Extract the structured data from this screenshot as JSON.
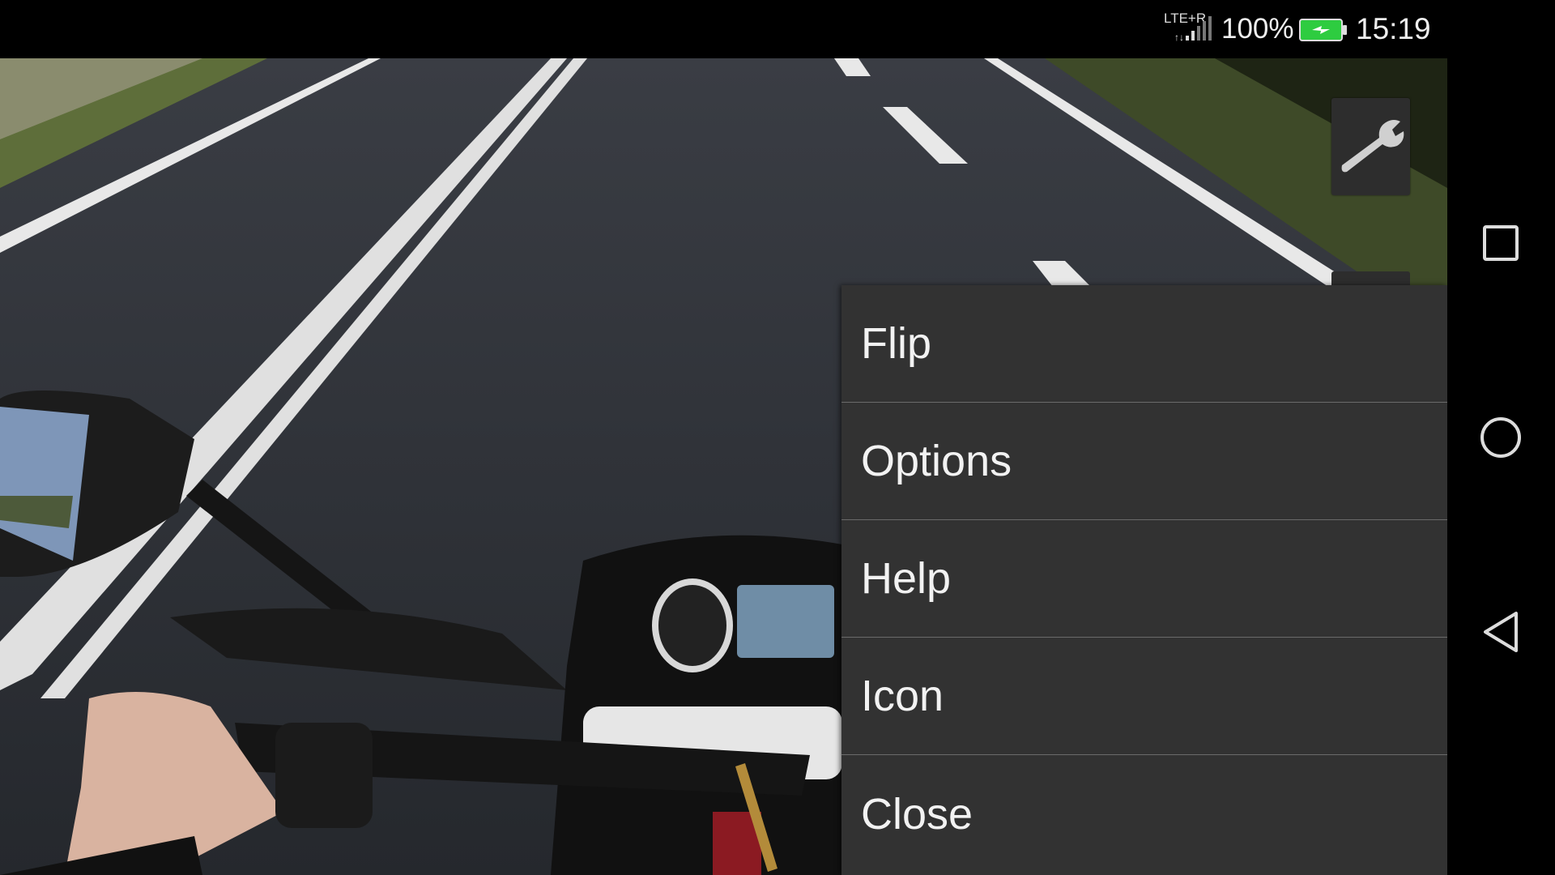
{
  "status_bar": {
    "network": "LTE+R",
    "battery_percent": "100%",
    "time": "15:19",
    "battery_color": "#2ecc40"
  },
  "toolbar": {
    "settings_icon": "wrench-icon"
  },
  "menu": {
    "items": [
      {
        "label": "Flip"
      },
      {
        "label": "Options"
      },
      {
        "label": "Help"
      },
      {
        "label": "Icon"
      },
      {
        "label": "Close"
      }
    ]
  },
  "nav_bar": {
    "buttons": [
      "recent-apps-icon",
      "home-icon",
      "back-icon"
    ]
  }
}
